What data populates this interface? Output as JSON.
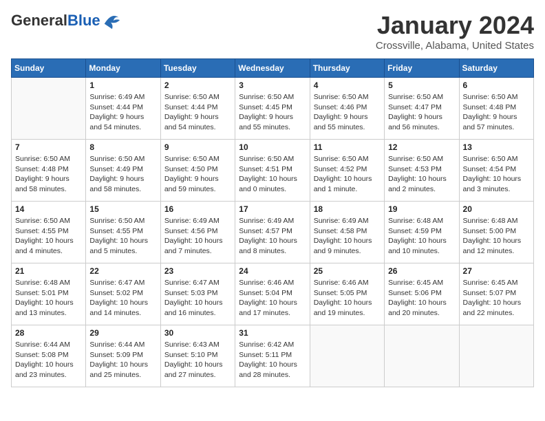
{
  "header": {
    "logo_general": "General",
    "logo_blue": "Blue",
    "month": "January 2024",
    "location": "Crossville, Alabama, United States"
  },
  "weekdays": [
    "Sunday",
    "Monday",
    "Tuesday",
    "Wednesday",
    "Thursday",
    "Friday",
    "Saturday"
  ],
  "weeks": [
    [
      {
        "day": "",
        "info": ""
      },
      {
        "day": "1",
        "info": "Sunrise: 6:49 AM\nSunset: 4:44 PM\nDaylight: 9 hours\nand 54 minutes."
      },
      {
        "day": "2",
        "info": "Sunrise: 6:50 AM\nSunset: 4:44 PM\nDaylight: 9 hours\nand 54 minutes."
      },
      {
        "day": "3",
        "info": "Sunrise: 6:50 AM\nSunset: 4:45 PM\nDaylight: 9 hours\nand 55 minutes."
      },
      {
        "day": "4",
        "info": "Sunrise: 6:50 AM\nSunset: 4:46 PM\nDaylight: 9 hours\nand 55 minutes."
      },
      {
        "day": "5",
        "info": "Sunrise: 6:50 AM\nSunset: 4:47 PM\nDaylight: 9 hours\nand 56 minutes."
      },
      {
        "day": "6",
        "info": "Sunrise: 6:50 AM\nSunset: 4:48 PM\nDaylight: 9 hours\nand 57 minutes."
      }
    ],
    [
      {
        "day": "7",
        "info": "Sunrise: 6:50 AM\nSunset: 4:48 PM\nDaylight: 9 hours\nand 58 minutes."
      },
      {
        "day": "8",
        "info": "Sunrise: 6:50 AM\nSunset: 4:49 PM\nDaylight: 9 hours\nand 58 minutes."
      },
      {
        "day": "9",
        "info": "Sunrise: 6:50 AM\nSunset: 4:50 PM\nDaylight: 9 hours\nand 59 minutes."
      },
      {
        "day": "10",
        "info": "Sunrise: 6:50 AM\nSunset: 4:51 PM\nDaylight: 10 hours\nand 0 minutes."
      },
      {
        "day": "11",
        "info": "Sunrise: 6:50 AM\nSunset: 4:52 PM\nDaylight: 10 hours\nand 1 minute."
      },
      {
        "day": "12",
        "info": "Sunrise: 6:50 AM\nSunset: 4:53 PM\nDaylight: 10 hours\nand 2 minutes."
      },
      {
        "day": "13",
        "info": "Sunrise: 6:50 AM\nSunset: 4:54 PM\nDaylight: 10 hours\nand 3 minutes."
      }
    ],
    [
      {
        "day": "14",
        "info": "Sunrise: 6:50 AM\nSunset: 4:55 PM\nDaylight: 10 hours\nand 4 minutes."
      },
      {
        "day": "15",
        "info": "Sunrise: 6:50 AM\nSunset: 4:55 PM\nDaylight: 10 hours\nand 5 minutes."
      },
      {
        "day": "16",
        "info": "Sunrise: 6:49 AM\nSunset: 4:56 PM\nDaylight: 10 hours\nand 7 minutes."
      },
      {
        "day": "17",
        "info": "Sunrise: 6:49 AM\nSunset: 4:57 PM\nDaylight: 10 hours\nand 8 minutes."
      },
      {
        "day": "18",
        "info": "Sunrise: 6:49 AM\nSunset: 4:58 PM\nDaylight: 10 hours\nand 9 minutes."
      },
      {
        "day": "19",
        "info": "Sunrise: 6:48 AM\nSunset: 4:59 PM\nDaylight: 10 hours\nand 10 minutes."
      },
      {
        "day": "20",
        "info": "Sunrise: 6:48 AM\nSunset: 5:00 PM\nDaylight: 10 hours\nand 12 minutes."
      }
    ],
    [
      {
        "day": "21",
        "info": "Sunrise: 6:48 AM\nSunset: 5:01 PM\nDaylight: 10 hours\nand 13 minutes."
      },
      {
        "day": "22",
        "info": "Sunrise: 6:47 AM\nSunset: 5:02 PM\nDaylight: 10 hours\nand 14 minutes."
      },
      {
        "day": "23",
        "info": "Sunrise: 6:47 AM\nSunset: 5:03 PM\nDaylight: 10 hours\nand 16 minutes."
      },
      {
        "day": "24",
        "info": "Sunrise: 6:46 AM\nSunset: 5:04 PM\nDaylight: 10 hours\nand 17 minutes."
      },
      {
        "day": "25",
        "info": "Sunrise: 6:46 AM\nSunset: 5:05 PM\nDaylight: 10 hours\nand 19 minutes."
      },
      {
        "day": "26",
        "info": "Sunrise: 6:45 AM\nSunset: 5:06 PM\nDaylight: 10 hours\nand 20 minutes."
      },
      {
        "day": "27",
        "info": "Sunrise: 6:45 AM\nSunset: 5:07 PM\nDaylight: 10 hours\nand 22 minutes."
      }
    ],
    [
      {
        "day": "28",
        "info": "Sunrise: 6:44 AM\nSunset: 5:08 PM\nDaylight: 10 hours\nand 23 minutes."
      },
      {
        "day": "29",
        "info": "Sunrise: 6:44 AM\nSunset: 5:09 PM\nDaylight: 10 hours\nand 25 minutes."
      },
      {
        "day": "30",
        "info": "Sunrise: 6:43 AM\nSunset: 5:10 PM\nDaylight: 10 hours\nand 27 minutes."
      },
      {
        "day": "31",
        "info": "Sunrise: 6:42 AM\nSunset: 5:11 PM\nDaylight: 10 hours\nand 28 minutes."
      },
      {
        "day": "",
        "info": ""
      },
      {
        "day": "",
        "info": ""
      },
      {
        "day": "",
        "info": ""
      }
    ]
  ]
}
